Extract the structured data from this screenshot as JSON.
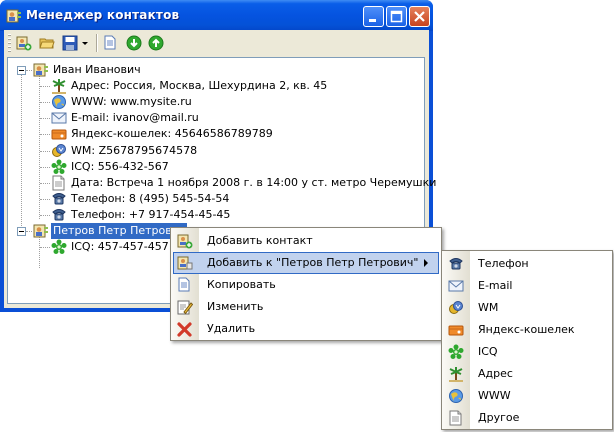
{
  "window": {
    "title": "Менеджер контактов",
    "buttons": {
      "minimize": "minimize",
      "maximize": "maximize",
      "close": "close"
    }
  },
  "toolbar": {
    "items": [
      {
        "name": "new-contact-icon"
      },
      {
        "name": "open-folder-icon"
      },
      {
        "name": "save-icon"
      },
      {
        "name": "copy-doc-icon"
      },
      {
        "name": "move-down-icon"
      },
      {
        "name": "move-up-icon"
      }
    ]
  },
  "tree": {
    "contacts": [
      {
        "name": "Иван Иванович",
        "expanded": true,
        "fields": [
          {
            "icon": "address-icon",
            "text": "Адрес: Россия, Москва, Шехурдина 2, кв. 45"
          },
          {
            "icon": "www-icon",
            "text": "WWW: www.mysite.ru"
          },
          {
            "icon": "email-icon",
            "text": "E-mail: ivanov@mail.ru"
          },
          {
            "icon": "yandex-wallet-icon",
            "text": "Яндекс-кошелек: 45646586789789"
          },
          {
            "icon": "wm-icon",
            "text": "WM: Z5678795674578"
          },
          {
            "icon": "icq-icon",
            "text": "ICQ: 556-432-567"
          },
          {
            "icon": "document-icon",
            "text": "Дата: Встреча 1 ноября 2008 г. в 14:00 у ст. метро Черемушки"
          },
          {
            "icon": "phone-icon",
            "text": "Телефон: 8 (495) 545-54-54"
          },
          {
            "icon": "phone-icon",
            "text": "Телефон: +7 917-454-45-45"
          }
        ]
      },
      {
        "name": "Петров Петр Петрович",
        "expanded": true,
        "selected": true,
        "fields": [
          {
            "icon": "icq-icon",
            "text": "ICQ: 457-457-457"
          }
        ]
      }
    ]
  },
  "context_menu": {
    "items": [
      {
        "icon": "add-contact-icon",
        "label": "Добавить контакт"
      },
      {
        "icon": "add-to-contact-icon",
        "label": "Добавить к \"Петров Петр Петрович\"",
        "submenu": true,
        "highlighted": true
      },
      {
        "icon": "copy-icon",
        "label": "Копировать"
      },
      {
        "icon": "edit-icon",
        "label": "Изменить"
      },
      {
        "icon": "delete-icon",
        "label": "Удалить"
      }
    ]
  },
  "submenu": {
    "items": [
      {
        "icon": "phone-icon",
        "label": "Телефон"
      },
      {
        "icon": "email-icon",
        "label": "E-mail"
      },
      {
        "icon": "wm-icon",
        "label": "WM"
      },
      {
        "icon": "yandex-wallet-icon",
        "label": "Яндекс-кошелек"
      },
      {
        "icon": "icq-icon",
        "label": "ICQ"
      },
      {
        "icon": "address-icon",
        "label": "Адрес"
      },
      {
        "icon": "www-icon",
        "label": "WWW"
      },
      {
        "icon": "document-icon",
        "label": "Другое"
      }
    ]
  },
  "colors": {
    "titlebar": "#0553e0",
    "window_bg": "#ece9d8",
    "selection": "#316ac5",
    "menu_highlight": "#c1d2ee"
  }
}
